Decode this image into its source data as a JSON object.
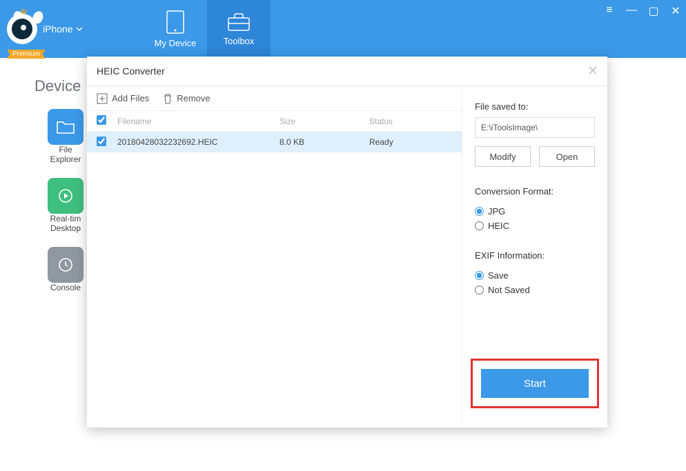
{
  "header": {
    "device_label": "iPhone",
    "premium_badge": "Premium",
    "tabs": [
      {
        "label": "My Device"
      },
      {
        "label": "Toolbox"
      }
    ]
  },
  "page": {
    "title": "Device",
    "tools": [
      {
        "label1": "File",
        "label2": "Explorer"
      },
      {
        "label1": "Real-tim",
        "label2": "Desktop"
      },
      {
        "label1": "Console",
        "label2": ""
      }
    ]
  },
  "modal": {
    "title": "HEIC Converter",
    "toolbar": {
      "add_files": "Add Files",
      "remove": "Remove"
    },
    "columns": {
      "filename": "Filename",
      "size": "Size",
      "status": "Status"
    },
    "rows": [
      {
        "filename": "20180428032232692.HEIC",
        "size": "8.0 KB",
        "status": "Ready"
      }
    ],
    "right": {
      "saved_to_label": "File saved to:",
      "saved_to_path": "E:\\iToolsImage\\",
      "modify": "Modify",
      "open": "Open",
      "format_label": "Conversion Format:",
      "format_jpg": "JPG",
      "format_heic": "HEIC",
      "exif_label": "EXIF Information:",
      "exif_save": "Save",
      "exif_notsave": "Not Saved",
      "start": "Start"
    }
  }
}
